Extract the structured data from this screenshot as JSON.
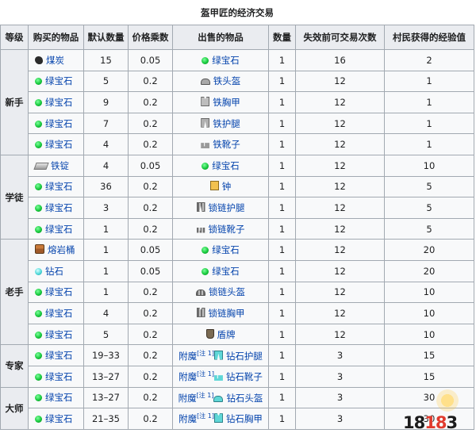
{
  "title": "盔甲匠的经济交易",
  "headers": [
    "等级",
    "购买的物品",
    "默认数量",
    "价格乘数",
    "出售的物品",
    "数量",
    "失效前可交易次数",
    "村民获得的经验值"
  ],
  "note_text": "[注 1]",
  "enchant_prefix": "附魔",
  "levels": [
    {
      "name": "新手",
      "rows": [
        {
          "buy_icon": "coal-icon",
          "buy": "煤炭",
          "qty": "15",
          "mult": "0.05",
          "sell_icon": "emerald-icon",
          "sell": "绿宝石",
          "sell_qty": "1",
          "uses": "16",
          "xp": "2"
        },
        {
          "buy_icon": "emerald-icon",
          "buy": "绿宝石",
          "qty": "5",
          "mult": "0.2",
          "sell_icon": "iron-helmet-icon",
          "sell": "铁头盔",
          "sell_qty": "1",
          "uses": "12",
          "xp": "1"
        },
        {
          "buy_icon": "emerald-icon",
          "buy": "绿宝石",
          "qty": "9",
          "mult": "0.2",
          "sell_icon": "iron-chestplate-icon",
          "sell": "铁胸甲",
          "sell_qty": "1",
          "uses": "12",
          "xp": "1"
        },
        {
          "buy_icon": "emerald-icon",
          "buy": "绿宝石",
          "qty": "7",
          "mult": "0.2",
          "sell_icon": "iron-leggings-icon",
          "sell": "铁护腿",
          "sell_qty": "1",
          "uses": "12",
          "xp": "1"
        },
        {
          "buy_icon": "emerald-icon",
          "buy": "绿宝石",
          "qty": "4",
          "mult": "0.2",
          "sell_icon": "iron-boots-icon",
          "sell": "铁靴子",
          "sell_qty": "1",
          "uses": "12",
          "xp": "1"
        }
      ]
    },
    {
      "name": "学徒",
      "rows": [
        {
          "buy_icon": "iron-ingot-icon",
          "buy": "铁锭",
          "qty": "4",
          "mult": "0.05",
          "sell_icon": "emerald-icon",
          "sell": "绿宝石",
          "sell_qty": "1",
          "uses": "12",
          "xp": "10"
        },
        {
          "buy_icon": "emerald-icon",
          "buy": "绿宝石",
          "qty": "36",
          "mult": "0.2",
          "sell_icon": "bell-icon",
          "sell": "钟",
          "sell_qty": "1",
          "uses": "12",
          "xp": "5"
        },
        {
          "buy_icon": "emerald-icon",
          "buy": "绿宝石",
          "qty": "3",
          "mult": "0.2",
          "sell_icon": "chain-leggings-icon",
          "sell": "锁链护腿",
          "sell_qty": "1",
          "uses": "12",
          "xp": "5"
        },
        {
          "buy_icon": "emerald-icon",
          "buy": "绿宝石",
          "qty": "1",
          "mult": "0.2",
          "sell_icon": "chain-boots-icon",
          "sell": "锁链靴子",
          "sell_qty": "1",
          "uses": "12",
          "xp": "5"
        }
      ]
    },
    {
      "name": "老手",
      "rows": [
        {
          "buy_icon": "lava-bucket-icon",
          "buy": "熔岩桶",
          "qty": "1",
          "mult": "0.05",
          "sell_icon": "emerald-icon",
          "sell": "绿宝石",
          "sell_qty": "1",
          "uses": "12",
          "xp": "20"
        },
        {
          "buy_icon": "diamond-icon",
          "buy": "钻石",
          "qty": "1",
          "mult": "0.05",
          "sell_icon": "emerald-icon",
          "sell": "绿宝石",
          "sell_qty": "1",
          "uses": "12",
          "xp": "20"
        },
        {
          "buy_icon": "emerald-icon",
          "buy": "绿宝石",
          "qty": "1",
          "mult": "0.2",
          "sell_icon": "chain-helmet-icon",
          "sell": "锁链头盔",
          "sell_qty": "1",
          "uses": "12",
          "xp": "10"
        },
        {
          "buy_icon": "emerald-icon",
          "buy": "绿宝石",
          "qty": "4",
          "mult": "0.2",
          "sell_icon": "chain-chestplate-icon",
          "sell": "锁链胸甲",
          "sell_qty": "1",
          "uses": "12",
          "xp": "10"
        },
        {
          "buy_icon": "emerald-icon",
          "buy": "绿宝石",
          "qty": "5",
          "mult": "0.2",
          "sell_icon": "shield-icon",
          "sell": "盾牌",
          "sell_qty": "1",
          "uses": "12",
          "xp": "10"
        }
      ]
    },
    {
      "name": "专家",
      "rows": [
        {
          "buy_icon": "emerald-icon",
          "buy": "绿宝石",
          "qty": "19–33",
          "mult": "0.2",
          "enchanted": true,
          "sell_icon": "diamond-leggings-icon",
          "sell": "钻石护腿",
          "sell_qty": "1",
          "uses": "3",
          "xp": "15"
        },
        {
          "buy_icon": "emerald-icon",
          "buy": "绿宝石",
          "qty": "13–27",
          "mult": "0.2",
          "enchanted": true,
          "sell_icon": "diamond-boots-icon",
          "sell": "钻石靴子",
          "sell_qty": "1",
          "uses": "3",
          "xp": "15"
        }
      ]
    },
    {
      "name": "大师",
      "rows": [
        {
          "buy_icon": "emerald-icon",
          "buy": "绿宝石",
          "qty": "13–27",
          "mult": "0.2",
          "enchanted": true,
          "sell_icon": "diamond-helmet-icon",
          "sell": "钻石头盔",
          "sell_qty": "1",
          "uses": "3",
          "xp": "30"
        },
        {
          "buy_icon": "emerald-icon",
          "buy": "绿宝石",
          "qty": "21–35",
          "mult": "0.2",
          "enchanted": true,
          "sell_icon": "diamond-chestplate-icon",
          "sell": "钻石胸甲",
          "sell_qty": "1",
          "uses": "3",
          "xp": "30"
        }
      ]
    }
  ],
  "watermark": {
    "prefix": "18",
    "accent": "18",
    "suffix": "3"
  }
}
